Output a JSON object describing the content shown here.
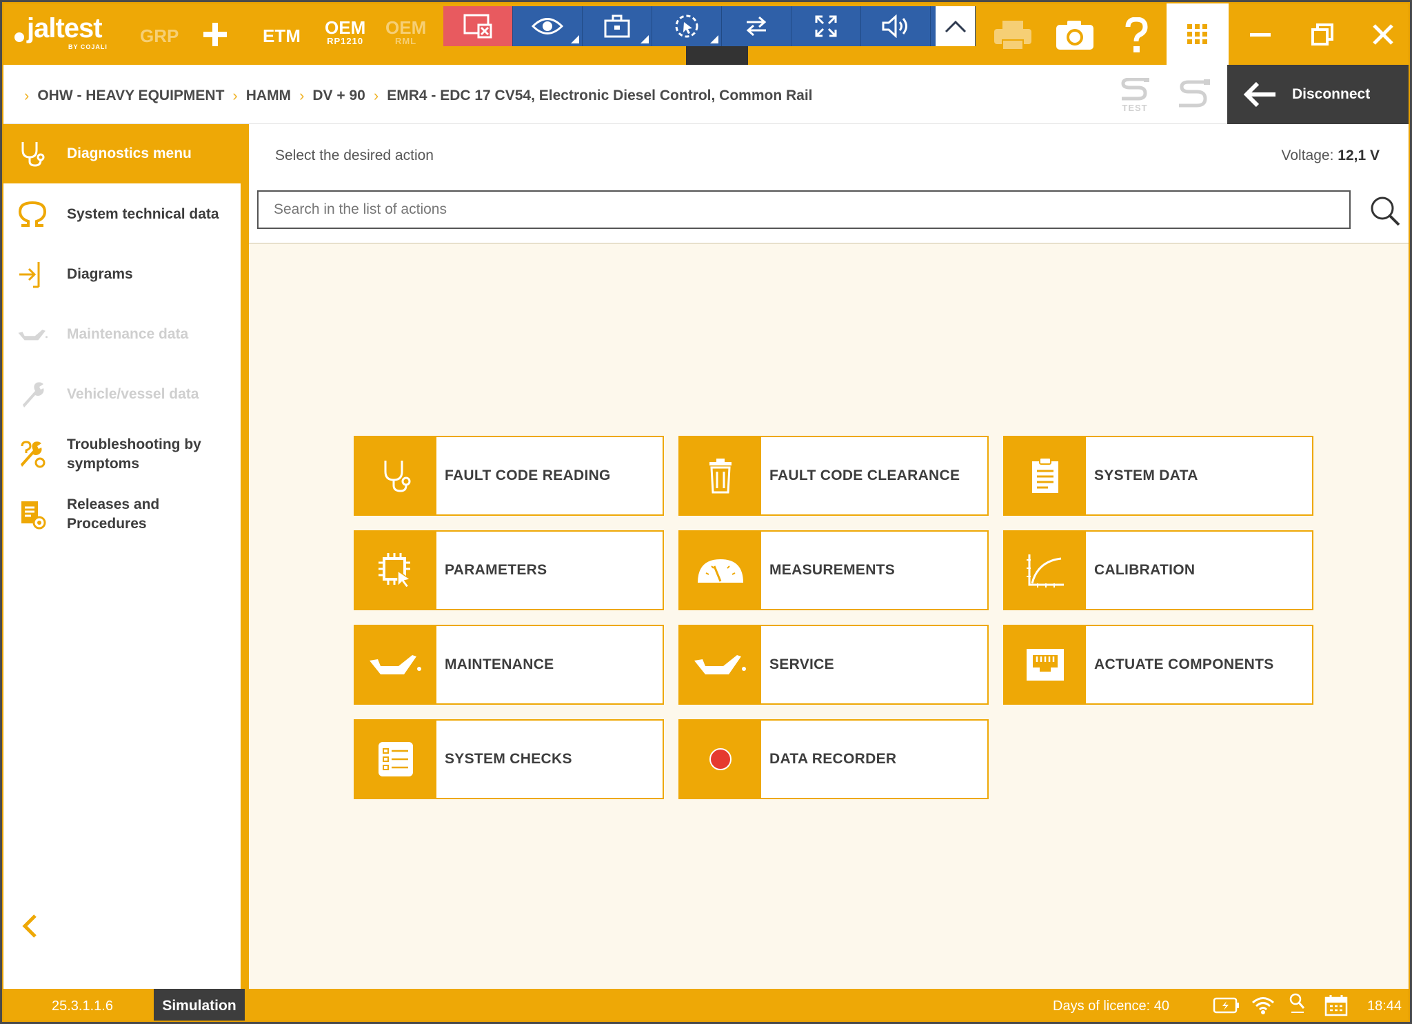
{
  "topbar": {
    "logo_word": "jaltest",
    "logo_sub": "BY COJALI",
    "grp": "GRP",
    "etm": "ETM",
    "oem1_title": "OEM",
    "oem1_sub": "RP1210",
    "oem2_title": "OEM",
    "oem2_sub": "RML"
  },
  "breadcrumb": {
    "items": [
      "OHW - HEAVY EQUIPMENT",
      "HAMM",
      "DV + 90",
      "EMR4 - EDC 17 CV54, Electronic Diesel Control, Common Rail"
    ],
    "test_label": "TEST",
    "disconnect": "Disconnect"
  },
  "sidebar": {
    "items": [
      {
        "label": "Diagnostics menu"
      },
      {
        "label": "System technical data"
      },
      {
        "label": "Diagrams"
      },
      {
        "label": "Maintenance data"
      },
      {
        "label": "Vehicle/vessel data"
      },
      {
        "label": "Troubleshooting by symptoms"
      },
      {
        "label": "Releases and Procedures"
      }
    ]
  },
  "main": {
    "prompt": "Select the desired action",
    "voltage_label": "Voltage:",
    "voltage_value": "12,1 V",
    "search_placeholder": "Search in the list of actions",
    "tiles": [
      {
        "label": "FAULT CODE READING"
      },
      {
        "label": "FAULT CODE CLEARANCE"
      },
      {
        "label": "SYSTEM DATA"
      },
      {
        "label": "PARAMETERS"
      },
      {
        "label": "MEASUREMENTS"
      },
      {
        "label": "CALIBRATION"
      },
      {
        "label": "MAINTENANCE"
      },
      {
        "label": "SERVICE"
      },
      {
        "label": "ACTUATE COMPONENTS"
      },
      {
        "label": "SYSTEM CHECKS"
      },
      {
        "label": "DATA RECORDER"
      }
    ]
  },
  "status": {
    "version": "25.3.1.1.6",
    "mode": "Simulation",
    "licence": "Days of licence: 40",
    "time": "18:44"
  },
  "colors": {
    "accent": "#eea806",
    "remote_bar": "#2f60a8",
    "dark": "#3d3d3d",
    "record": "#e53a2f"
  }
}
